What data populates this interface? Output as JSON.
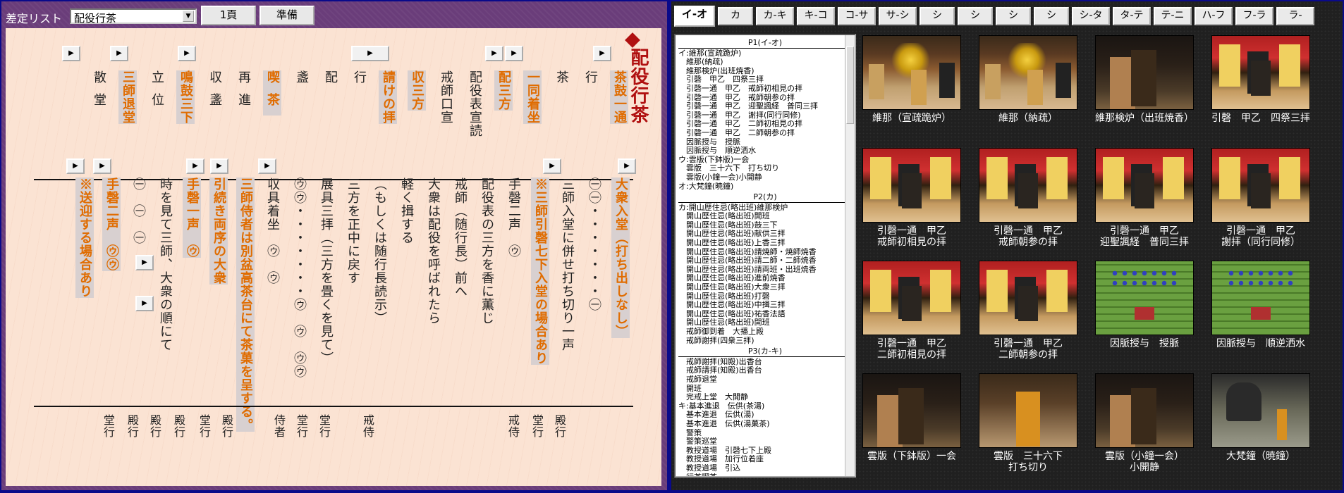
{
  "left": {
    "title": "差定リスト",
    "select_value": "配役行茶",
    "buttons": {
      "page": "1頁",
      "prep": "準備"
    },
    "ceremony_title": "配役行茶",
    "upper_cols": [
      [
        "茶鼓一通",
        true
      ],
      [
        "行",
        false
      ],
      [
        "茶",
        false
      ],
      [
        "一同着坐",
        true
      ],
      [
        "配三方",
        true
      ],
      [
        "配役表宣読",
        false
      ],
      [
        "戒師口宣",
        false
      ],
      [
        "収三方",
        true
      ],
      [
        "請けの拝",
        true
      ],
      [
        "行",
        false
      ],
      [
        "配",
        false
      ],
      [
        "盞",
        false
      ],
      [
        "喫茶",
        true
      ],
      [
        "再進",
        false
      ],
      [
        "収盞",
        false
      ],
      [
        "鳴鼓三下",
        true
      ],
      [
        "立位",
        false
      ],
      [
        "三師退堂",
        true
      ],
      [
        "散堂",
        false
      ]
    ],
    "lower_cols": [
      [
        "大衆入堂（打ち出しなし）",
        true
      ],
      [
        "㊀㊀・・・・・・・㊀",
        false
      ],
      [
        "三師入堂に併せ打ち切り一声",
        false
      ],
      [
        "※三師引磬七下入堂の場合あり",
        true
      ],
      [
        "手磬二声　㋒",
        false
      ],
      [
        "配役表の三方を香に薫じ",
        false
      ],
      [
        "戒師（随行長）前へ",
        false
      ],
      [
        "大衆は配役を呼ばれたら",
        false
      ],
      [
        "軽く揖する",
        false
      ],
      [
        "（もしくは随行長読示）",
        false
      ],
      [
        "三方を正中に戻す",
        false
      ],
      [
        "展具三拝（三方を畳くを見て）",
        false
      ],
      [
        "㋒㋒・・・・・・・㋒　㋒　㋒㋒",
        false
      ],
      [
        "収具着坐　㋒　㋒",
        false
      ],
      [
        "三師侍者は別盆高茶台にて茶菓を呈する。",
        true
      ],
      [
        "引続き両序の大衆",
        true
      ],
      [
        "手磬一声　㋒",
        true
      ],
      [
        "時を見て三師、大衆の順にて",
        false
      ],
      [
        "㊀　㊀　㊀",
        false
      ],
      [
        "手磬二声　㋒㋒",
        true
      ],
      [
        "※送迎する場合あり",
        true
      ]
    ],
    "bottom_cols": [
      "殿行",
      "堂行",
      "戒侍",
      "戒侍",
      "堂行",
      "堂行",
      "侍者",
      "殿行",
      "堂行",
      "殿行",
      "殿行",
      "殿行",
      "堂行"
    ]
  },
  "right": {
    "tabs": [
      "イ-オ",
      "カ",
      "カ-キ",
      "キ-コ",
      "コ-サ",
      "サ-シ",
      "シ",
      "シ",
      "シ",
      "シ",
      "シ-タ",
      "タ-テ",
      "テ-ニ",
      "ハ-フ",
      "フ-ラ",
      "ラ-"
    ],
    "toc": [
      {
        "sep": "P1(イ-オ)"
      },
      "イ:維那(宣疏跪炉)",
      "　維那(納疏)",
      "　維那検炉(出班焼香)",
      "　引磬　甲乙　四祭三拝",
      "　引磬一通　甲乙　戒師初相見の拝",
      "　引磬一通　甲乙　戒師朝参の拝",
      "　引磬一通　甲乙　迎聖諷経　普同三拝",
      "　引磬一通　甲乙　謝拝(同行同修)",
      "　引磬一通　甲乙　二師初相見の拝",
      "　引磬一通　甲乙　二師朝参の拝",
      "　因脈授与　授脈",
      "　因脈授与　順逆洒水",
      "ウ:雲版(下鉢版)一会",
      "　雲版　三十六下　打ち切り",
      "　雲版(小鐘一会)小開静",
      "オ:大梵鐘(暁鐘)",
      {
        "sep": "P2(カ)"
      },
      "カ:開山歴住忌(略出班)維那検炉",
      "　開山歴住忌(略出班)開班",
      "　開山歴住忌(略出班)鼓三下",
      "　開山歴住忌(略出班)献供三拝",
      "　開山歴住忌(略出班)上香三拝",
      "　開山歴住忌(略出班)請焼師・焼師焼香",
      "　開山歴住忌(略出班)請二師・二師焼香",
      "　開山歴住忌(略出班)請両班・出班焼香",
      "　開山歴住忌(略出班)進前焼香",
      "　開山歴住忌(略出班)大衆三拝",
      "　開山歴住忌(略出班)打磬",
      "　開山歴住忌(略出班)中揖三拝",
      "　開山歴住忌(略出班)祐香法語",
      "　開山歴住忌(略出班)開班",
      "　戒師御到着　大播上殿",
      "　戒師謝拝(四衆三拝)",
      {
        "sep": "P3(カ-キ)"
      },
      "　戒師謝拝(知殿)出香台",
      "　戒師請拝(知殿)出香台",
      "　戒師退堂",
      "　開班",
      "　完戒上堂　大開静",
      "キ:基本進退　伝供(茶湯)",
      "　基本進退　伝供(湯)",
      "　基本進退　伝供(湯菓茶)",
      "　警策",
      "　警策巡堂",
      "　教授道場　引磬七下上殿",
      "　教授道場　加行位着座",
      "　教授道場　引込",
      "　行茶喫茶"
    ],
    "thumbs": [
      {
        "cap1": "維那（宣疏跪炉）",
        "cap2": "",
        "scene": "temple"
      },
      {
        "cap1": "維那（納疏）",
        "cap2": "",
        "scene": "temple"
      },
      {
        "cap1": "維那検炉（出班焼香）",
        "cap2": "",
        "scene": "dark"
      },
      {
        "cap1": "引磬　甲乙　四祭三拝",
        "cap2": "",
        "scene": "altar"
      },
      {
        "cap1": "引磬一通　甲乙",
        "cap2": "戒師初相見の拝",
        "scene": "altar"
      },
      {
        "cap1": "引磬一通　甲乙",
        "cap2": "戒師朝参の拝",
        "scene": "altar"
      },
      {
        "cap1": "引磬一通　甲乙",
        "cap2": "迎聖諷経　普同三拝",
        "scene": "altar"
      },
      {
        "cap1": "引磬一通　甲乙",
        "cap2": "謝拝（同行同修）",
        "scene": "altar"
      },
      {
        "cap1": "引磬一通　甲乙",
        "cap2": "二師初相見の拝",
        "scene": "altar"
      },
      {
        "cap1": "引磬一通　甲乙",
        "cap2": "二師朝参の拝",
        "scene": "altar"
      },
      {
        "cap1": "因脈授与　授脈",
        "cap2": "",
        "scene": "green"
      },
      {
        "cap1": "因脈授与　順逆洒水",
        "cap2": "",
        "scene": "green"
      },
      {
        "cap1": "雲版（下鉢版）一会",
        "cap2": "",
        "scene": "dark"
      },
      {
        "cap1": "雲版　三十六下",
        "cap2": "打ち切り",
        "scene": "hall"
      },
      {
        "cap1": "雲版（小鐘一会）",
        "cap2": "小開静",
        "scene": "dark"
      },
      {
        "cap1": "大梵鐘（暁鐘）",
        "cap2": "",
        "scene": "bell"
      }
    ]
  }
}
